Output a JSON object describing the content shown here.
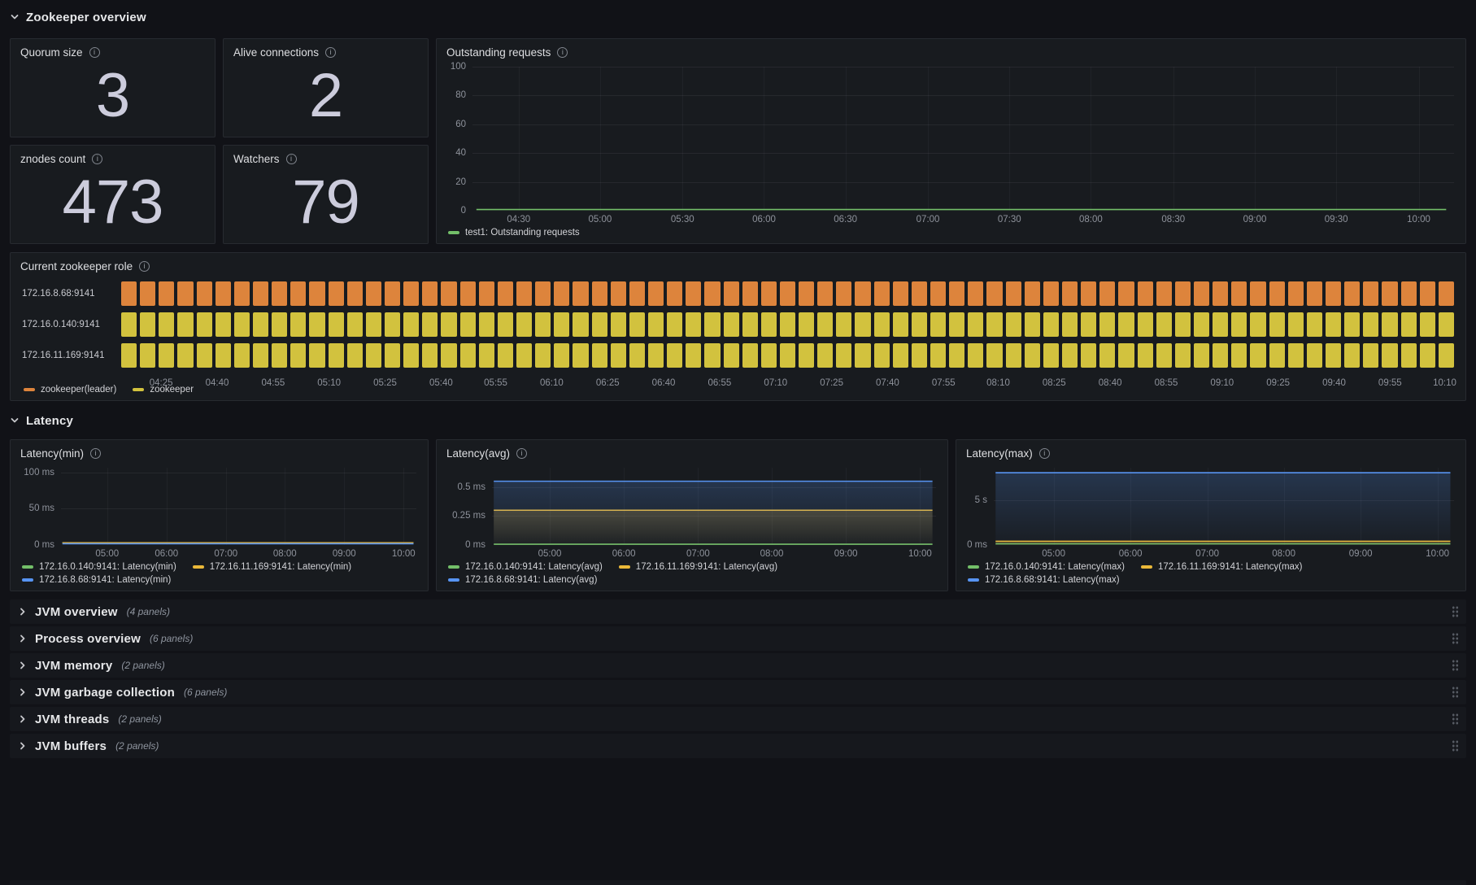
{
  "sections": {
    "zookeeper": {
      "title": "Zookeeper overview"
    },
    "latency": {
      "title": "Latency"
    }
  },
  "stats": [
    {
      "title": "Quorum size",
      "value": "3"
    },
    {
      "title": "Alive connections",
      "value": "2"
    },
    {
      "title": "znodes count",
      "value": "473"
    },
    {
      "title": "Watchers",
      "value": "79"
    }
  ],
  "colors": {
    "green": "#73BF69",
    "yellow": "#EAB839",
    "blue": "#5794F2",
    "role_orange": "#DD843C",
    "role_yellow": "#D2C23E",
    "panel_bg": "#181B1F",
    "page_bg": "#111217"
  },
  "charts": {
    "outstanding": {
      "title": "Outstanding requests",
      "type": "xy",
      "axisw": 26,
      "yticks": [
        {
          "label": "100",
          "f": 0
        },
        {
          "label": "80",
          "f": 0.2
        },
        {
          "label": "60",
          "f": 0.4
        },
        {
          "label": "40",
          "f": 0.6
        },
        {
          "label": "20",
          "f": 0.8
        },
        {
          "label": "0",
          "f": 1
        }
      ],
      "xticks": [
        {
          "label": "04:30",
          "f": 0.047
        },
        {
          "label": "05:00",
          "f": 0.13
        },
        {
          "label": "05:30",
          "f": 0.214
        },
        {
          "label": "06:00",
          "f": 0.297
        },
        {
          "label": "06:30",
          "f": 0.38
        },
        {
          "label": "07:00",
          "f": 0.464
        },
        {
          "label": "07:30",
          "f": 0.547
        },
        {
          "label": "08:00",
          "f": 0.63
        },
        {
          "label": "08:30",
          "f": 0.714
        },
        {
          "label": "09:00",
          "f": 0.797
        },
        {
          "label": "09:30",
          "f": 0.88
        },
        {
          "label": "10:00",
          "f": 0.964
        }
      ],
      "series": [
        {
          "name": "test1: Outstanding requests",
          "color": "#73BF69",
          "points": [
            [
              0.004,
              0.992
            ],
            [
              0.992,
              0.992
            ]
          ]
        }
      ],
      "legend": [
        [
          {
            "label": "test1: Outstanding requests",
            "color": "#73BF69"
          }
        ]
      ]
    },
    "role": {
      "title": "Current zookeeper role",
      "type": "timeline",
      "segments": 71,
      "rows": [
        {
          "label": "172.16.8.68:9141",
          "color": "#DD843C",
          "state": "zookeeper(leader)"
        },
        {
          "label": "172.16.0.140:9141",
          "color": "#D2C23E",
          "state": "zookeeper"
        },
        {
          "label": "172.16.11.169:9141",
          "color": "#D2C23E",
          "state": "zookeeper"
        }
      ],
      "xticks": [
        {
          "label": "04:25",
          "f": 0.03
        },
        {
          "label": "04:40",
          "f": 0.072
        },
        {
          "label": "04:55",
          "f": 0.114
        },
        {
          "label": "05:10",
          "f": 0.156
        },
        {
          "label": "05:25",
          "f": 0.198
        },
        {
          "label": "05:40",
          "f": 0.24
        },
        {
          "label": "05:55",
          "f": 0.281
        },
        {
          "label": "06:10",
          "f": 0.323
        },
        {
          "label": "06:25",
          "f": 0.365
        },
        {
          "label": "06:40",
          "f": 0.407
        },
        {
          "label": "06:55",
          "f": 0.449
        },
        {
          "label": "07:10",
          "f": 0.491
        },
        {
          "label": "07:25",
          "f": 0.533
        },
        {
          "label": "07:40",
          "f": 0.575
        },
        {
          "label": "07:55",
          "f": 0.617
        },
        {
          "label": "08:10",
          "f": 0.658
        },
        {
          "label": "08:25",
          "f": 0.7
        },
        {
          "label": "08:40",
          "f": 0.742
        },
        {
          "label": "08:55",
          "f": 0.784
        },
        {
          "label": "09:10",
          "f": 0.826
        },
        {
          "label": "09:25",
          "f": 0.868
        },
        {
          "label": "09:40",
          "f": 0.91
        },
        {
          "label": "09:55",
          "f": 0.952
        },
        {
          "label": "10:10",
          "f": 0.993
        }
      ],
      "legend": [
        [
          {
            "label": "zookeeper(leader)",
            "color": "#DD843C"
          },
          {
            "label": "zookeeper",
            "color": "#D2C23E"
          }
        ]
      ]
    },
    "lat_min": {
      "title": "Latency(min)",
      "type": "xy",
      "axisw": 44,
      "yticks": [
        {
          "label": "100 ms",
          "f": 0.06
        },
        {
          "label": "50 ms",
          "f": 0.53
        },
        {
          "label": "0 ms",
          "f": 1
        }
      ],
      "xticks": [
        {
          "label": "05:00",
          "f": 0.13
        },
        {
          "label": "06:00",
          "f": 0.297
        },
        {
          "label": "07:00",
          "f": 0.464
        },
        {
          "label": "08:00",
          "f": 0.63
        },
        {
          "label": "09:00",
          "f": 0.797
        },
        {
          "label": "10:00",
          "f": 0.964
        }
      ],
      "series": [
        {
          "name": "172.16.0.140:9141: Latency(min)",
          "color": "#73BF69",
          "points": [
            [
              0.004,
              0.972
            ],
            [
              0.992,
              0.972
            ]
          ]
        },
        {
          "name": "172.16.11.169:9141: Latency(min)",
          "color": "#EAB839",
          "points": [
            [
              0.004,
              0.972
            ],
            [
              0.992,
              0.972
            ]
          ]
        },
        {
          "name": "172.16.8.68:9141: Latency(min)",
          "color": "#5794F2",
          "points": [
            [
              0.004,
              0.984
            ],
            [
              0.992,
              0.984
            ]
          ]
        }
      ],
      "legend": [
        [
          {
            "label": "172.16.0.140:9141: Latency(min)",
            "color": "#73BF69"
          },
          {
            "label": "172.16.11.169:9141: Latency(min)",
            "color": "#EAB839"
          }
        ],
        [
          {
            "label": "172.16.8.68:9141: Latency(min)",
            "color": "#5794F2"
          }
        ]
      ]
    },
    "lat_avg": {
      "title": "Latency(avg)",
      "type": "xy",
      "axisw": 50,
      "yticks": [
        {
          "label": "0.5 ms",
          "f": 0.25
        },
        {
          "label": "0.25 ms",
          "f": 0.625
        },
        {
          "label": "0 ms",
          "f": 1
        }
      ],
      "xticks": [
        {
          "label": "05:00",
          "f": 0.13
        },
        {
          "label": "06:00",
          "f": 0.297
        },
        {
          "label": "07:00",
          "f": 0.464
        },
        {
          "label": "08:00",
          "f": 0.63
        },
        {
          "label": "09:00",
          "f": 0.797
        },
        {
          "label": "10:00",
          "f": 0.964
        }
      ],
      "series": [
        {
          "name": "172.16.0.140:9141: Latency(avg)",
          "color": "#73BF69",
          "points": [
            [
              0.004,
              0.99
            ],
            [
              0.992,
              0.99
            ]
          ]
        },
        {
          "name": "172.16.11.169:9141: Latency(avg)",
          "color": "#EAB839",
          "fill": "#EAB839",
          "points": [
            [
              0.004,
              0.55
            ],
            [
              0.992,
              0.55
            ]
          ]
        },
        {
          "name": "172.16.8.68:9141: Latency(avg)",
          "color": "#5794F2",
          "fill": "#5794F2",
          "points": [
            [
              0.004,
              0.175
            ],
            [
              0.992,
              0.175
            ]
          ]
        }
      ],
      "legend": [
        [
          {
            "label": "172.16.0.140:9141: Latency(avg)",
            "color": "#73BF69"
          },
          {
            "label": "172.16.11.169:9141: Latency(avg)",
            "color": "#EAB839"
          }
        ],
        [
          {
            "label": "172.16.8.68:9141: Latency(avg)",
            "color": "#5794F2"
          }
        ]
      ]
    },
    "lat_max": {
      "title": "Latency(max)",
      "type": "xy",
      "axisw": 28,
      "yticks": [
        {
          "label": "5 s",
          "f": 0.42
        },
        {
          "label": "0 ms",
          "f": 1
        }
      ],
      "xticks": [
        {
          "label": "05:00",
          "f": 0.13
        },
        {
          "label": "06:00",
          "f": 0.297
        },
        {
          "label": "07:00",
          "f": 0.464
        },
        {
          "label": "08:00",
          "f": 0.63
        },
        {
          "label": "09:00",
          "f": 0.797
        },
        {
          "label": "10:00",
          "f": 0.964
        }
      ],
      "series": [
        {
          "name": "172.16.0.140:9141: Latency(max)",
          "color": "#73BF69",
          "points": [
            [
              0.004,
              0.985
            ],
            [
              0.992,
              0.985
            ]
          ]
        },
        {
          "name": "172.16.11.169:9141: Latency(max)",
          "color": "#EAB839",
          "fill": "#EAB839",
          "points": [
            [
              0.004,
              0.952
            ],
            [
              0.992,
              0.952
            ]
          ]
        },
        {
          "name": "172.16.8.68:9141: Latency(max)",
          "color": "#5794F2",
          "fill": "#5794F2",
          "points": [
            [
              0.004,
              0.065
            ],
            [
              0.992,
              0.065
            ]
          ]
        }
      ],
      "legend": [
        [
          {
            "label": "172.16.0.140:9141: Latency(max)",
            "color": "#73BF69"
          },
          {
            "label": "172.16.11.169:9141: Latency(max)",
            "color": "#EAB839"
          }
        ],
        [
          {
            "label": "172.16.8.68:9141: Latency(max)",
            "color": "#5794F2"
          }
        ]
      ]
    }
  },
  "collapsed_rows": [
    {
      "title": "JVM overview",
      "count": "(4 panels)"
    },
    {
      "title": "Process overview",
      "count": "(6 panels)"
    },
    {
      "title": "JVM memory",
      "count": "(2 panels)"
    },
    {
      "title": "JVM garbage collection",
      "count": "(6 panels)"
    },
    {
      "title": "JVM threads",
      "count": "(2 panels)"
    },
    {
      "title": "JVM buffers",
      "count": "(2 panels)"
    }
  ],
  "chart_data": [
    {
      "type": "stat",
      "title": "Quorum size",
      "value": 3
    },
    {
      "type": "stat",
      "title": "Alive connections",
      "value": 2
    },
    {
      "type": "stat",
      "title": "znodes count",
      "value": 473
    },
    {
      "type": "stat",
      "title": "Watchers",
      "value": 79
    },
    {
      "type": "line",
      "title": "Outstanding requests",
      "ylim": [
        0,
        100
      ],
      "yticks": [
        0,
        20,
        40,
        60,
        80,
        100
      ],
      "xticks": [
        "04:30",
        "05:00",
        "05:30",
        "06:00",
        "06:30",
        "07:00",
        "07:30",
        "08:00",
        "08:30",
        "09:00",
        "09:30",
        "10:00"
      ],
      "series": [
        {
          "name": "test1: Outstanding requests",
          "value": 0,
          "shape": "flat"
        }
      ],
      "grid": true,
      "legend_position": "bottom"
    },
    {
      "type": "state-timeline",
      "title": "Current zookeeper role",
      "xticks": [
        "04:25",
        "04:40",
        "04:55",
        "05:10",
        "05:25",
        "05:40",
        "05:55",
        "06:10",
        "06:25",
        "06:40",
        "06:55",
        "07:10",
        "07:25",
        "07:40",
        "07:55",
        "08:10",
        "08:25",
        "08:40",
        "08:55",
        "09:10",
        "09:25",
        "09:40",
        "09:55",
        "10:10"
      ],
      "rows": [
        {
          "name": "172.16.8.68:9141",
          "state": "zookeeper(leader)"
        },
        {
          "name": "172.16.0.140:9141",
          "state": "zookeeper"
        },
        {
          "name": "172.16.11.169:9141",
          "state": "zookeeper"
        }
      ],
      "states": [
        "zookeeper(leader)",
        "zookeeper"
      ]
    },
    {
      "type": "line",
      "title": "Latency(min)",
      "ylim_ms": [
        0,
        100
      ],
      "yticks": [
        "0 ms",
        "50 ms",
        "100 ms"
      ],
      "series": [
        {
          "name": "172.16.0.140:9141: Latency(min)",
          "approx_ms": 0
        },
        {
          "name": "172.16.11.169:9141: Latency(min)",
          "approx_ms": 0
        },
        {
          "name": "172.16.8.68:9141: Latency(min)",
          "approx_ms": 0
        }
      ]
    },
    {
      "type": "line",
      "title": "Latency(avg)",
      "ylim_ms": [
        0,
        0.65
      ],
      "yticks": [
        "0 ms",
        "0.25 ms",
        "0.5 ms"
      ],
      "series": [
        {
          "name": "172.16.0.140:9141: Latency(avg)",
          "approx_ms": 0
        },
        {
          "name": "172.16.11.169:9141: Latency(avg)",
          "approx_ms": 0.3
        },
        {
          "name": "172.16.8.68:9141: Latency(avg)",
          "approx_ms": 0.55
        }
      ]
    },
    {
      "type": "line",
      "title": "Latency(max)",
      "ylim_s": [
        0,
        8.5
      ],
      "yticks": [
        "0 ms",
        "5 s"
      ],
      "series": [
        {
          "name": "172.16.0.140:9141: Latency(max)",
          "approx_s": 0
        },
        {
          "name": "172.16.11.169:9141: Latency(max)",
          "approx_s": 0.35
        },
        {
          "name": "172.16.8.68:9141: Latency(max)",
          "approx_s": 8
        }
      ]
    }
  ]
}
